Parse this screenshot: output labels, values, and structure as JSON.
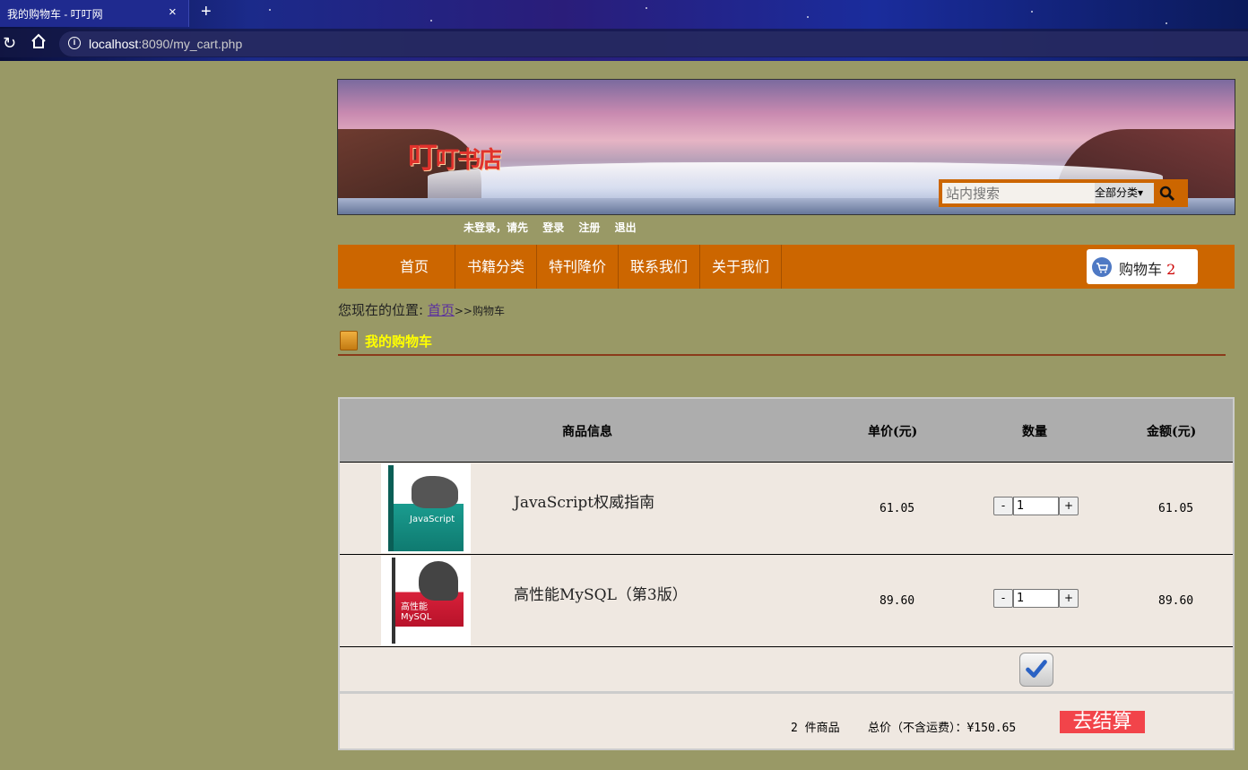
{
  "browser": {
    "tab_title": "我的购物车 - 叮叮网",
    "tab_close": "×",
    "new_tab": "+",
    "url_host": "localhost",
    "url_path": ":8090/my_cart.php"
  },
  "banner": {
    "logo_big": "叮",
    "logo_small": "叮书店",
    "search_placeholder": "站内搜索",
    "search_category": "全部分类▾"
  },
  "login_bar": {
    "prompt": "未登录，请先",
    "login": "登录",
    "register": "注册",
    "logout": "退出"
  },
  "nav": {
    "items": [
      "首页",
      "书籍分类",
      "特刊降价",
      "联系我们",
      "关于我们"
    ],
    "cart_label": "购物车",
    "cart_count": "2"
  },
  "breadcrumb": {
    "prefix": "您现在的位置:",
    "home": "首页",
    "separator": ">>",
    "current": "购物车"
  },
  "cart": {
    "title": "我的购物车",
    "headers": {
      "info": "商品信息",
      "unit_price": "单价(元)",
      "quantity": "数量",
      "amount": "金额(元)"
    },
    "rows": [
      {
        "name": "JavaScript权威指南",
        "price": "61.05",
        "qty": "1",
        "total": "61.05",
        "cover_text": "JavaScript",
        "minus": "-",
        "plus": "+"
      },
      {
        "name": "高性能MySQL（第3版）",
        "price": "89.60",
        "qty": "1",
        "total": "89.60",
        "cover_text": "高性能 MySQL",
        "minus": "-",
        "plus": "+"
      }
    ],
    "summary": {
      "count_text": "2 件商品",
      "total_text": "总价（不含运费）：¥150.65",
      "checkout": "去结算"
    }
  },
  "colors": {
    "page_bg": "#999966",
    "nav_bg": "#cc6600",
    "title_yellow": "#ffff00",
    "checkout_bg": "#f2444a"
  }
}
